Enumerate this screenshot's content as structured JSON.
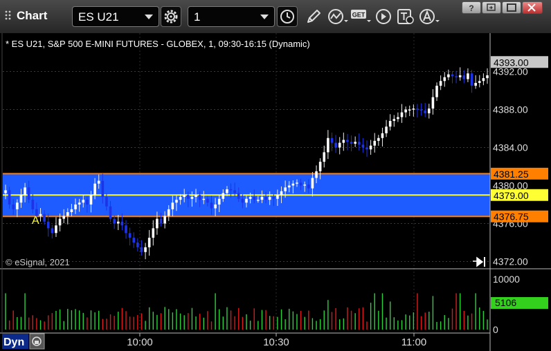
{
  "toolbar": {
    "title": "Chart",
    "symbol": "ES U21",
    "interval": "1"
  },
  "chart": {
    "header": "* ES U21, S&P 500 E-MINI FUTURES - GLOBEX, 1, 09:30-16:15 (Dynamic)",
    "copyright": "© eSignal, 2021",
    "annotation": "A",
    "dyn_label": "Dyn",
    "colors": {
      "band": "#1f5cff",
      "up": "#ffffff",
      "down": "#1c33e8",
      "orange_line": "#ff7f00",
      "yellow_line": "#ffff33",
      "vol_up": "#2bd33b",
      "vol_down": "#e01818"
    }
  },
  "chart_data": [
    {
      "type": "candlestick",
      "title": "* ES U21, S&P 500 E-MINI FUTURES - GLOBEX, 1, 09:30-16:15 (Dynamic)",
      "x_ticks": [
        "10:00",
        "10:30",
        "11:00"
      ],
      "y_ticks": [
        4392.0,
        4388.0,
        4384.0,
        4380.0,
        4376.0,
        4372.0
      ],
      "ylim": [
        4371.5,
        4394.0
      ],
      "price_markers": [
        {
          "label": "4393.00",
          "value": 4393.0,
          "color": "#c8c8c8"
        },
        {
          "label": "4381.25",
          "value": 4381.25,
          "color": "#ff7f00"
        },
        {
          "label": "4379.00",
          "value": 4379.0,
          "color": "#ffff33"
        },
        {
          "label": "4376.75",
          "value": 4376.75,
          "color": "#ff7f00"
        }
      ],
      "band": [
        4376.75,
        4381.25
      ],
      "close_series": [
        4379.5,
        4378.0,
        4377.5,
        4378.2,
        4379.0,
        4379.8,
        4378.5,
        4377.5,
        4376.8,
        4377.0,
        4376.2,
        4375.5,
        4375.0,
        4375.8,
        4376.5,
        4376.8,
        4377.2,
        4377.5,
        4378.0,
        4378.2,
        4378.5,
        4378.0,
        4379.0,
        4380.2,
        4380.5,
        4378.8,
        4377.8,
        4376.5,
        4376.0,
        4376.2,
        4375.8,
        4375.0,
        4374.5,
        4374.0,
        4373.5,
        4373.0,
        4373.5,
        4374.5,
        4375.5,
        4376.5,
        4376.0,
        4376.8,
        4377.5,
        4378.2,
        4378.5,
        4378.8,
        4379.0,
        4378.6,
        4378.8,
        4379.0,
        4378.5,
        4378.6,
        4378.2,
        4377.6,
        4378.0,
        4378.6,
        4379.2,
        4379.6,
        4379.5,
        4379.2,
        4378.6,
        4378.2,
        4378.6,
        4378.8,
        4378.5,
        4378.5,
        4378.8,
        4378.5,
        4378.8,
        4378.6,
        4379.0,
        4379.4,
        4379.8,
        4380.0,
        4380.2,
        4380.3,
        4380.0,
        4380.1,
        4379.7,
        4380.8,
        4381.5,
        4382.5,
        4383.5,
        4385.0,
        4384.5,
        4384.0,
        4384.5,
        4384.8,
        4384.6,
        4384.4,
        4384.6,
        4384.3,
        4384.0,
        4383.8,
        4384.2,
        4384.7,
        4385.0,
        4385.5,
        4386.2,
        4386.8,
        4387.0,
        4387.2,
        4387.7,
        4388.0,
        4388.0,
        4388.1,
        4388.0,
        4387.9,
        4387.6,
        4388.1,
        4389.3,
        4390.5,
        4391.0,
        4391.4,
        4391.7,
        4391.5,
        4391.4,
        4391.6,
        4391.2,
        4391.8,
        4390.5,
        4390.8,
        4391.0,
        4391.3,
        4391.6
      ],
      "volume": {
        "ylim": [
          0,
          10000
        ],
        "y_ticks": [
          10000,
          0
        ],
        "last_value_label": "5106",
        "last_value": 5106
      }
    }
  ]
}
